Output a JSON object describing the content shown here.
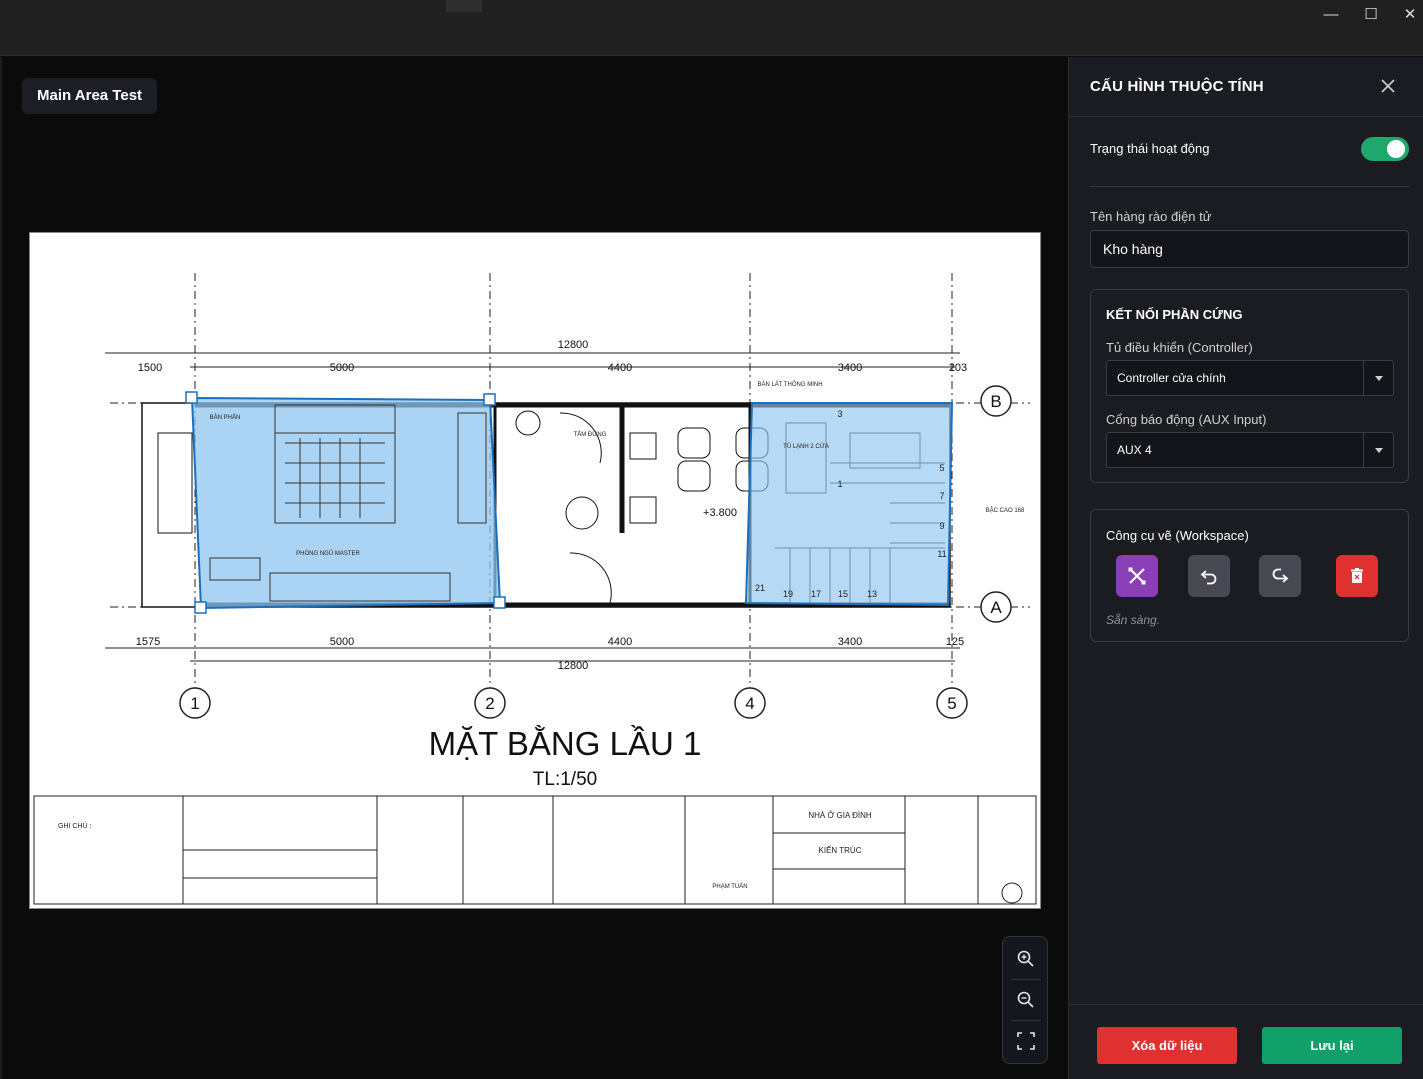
{
  "window": {
    "minimize_glyph": "—",
    "maximize_glyph": "☐",
    "close_glyph": "✕"
  },
  "canvas": {
    "area_name": "Main Area Test",
    "drawing": {
      "title": "MẶT BẰNG LẦU 1",
      "scale": "TL:1/50",
      "dim_top_total": "12800",
      "dim_bottom_total": "12800",
      "dim_top": [
        "1500",
        "5000",
        "4400",
        "3400",
        "203"
      ],
      "dim_bottom": [
        "1575",
        "5000",
        "4400",
        "3400",
        "125"
      ],
      "grid_columns": [
        "1",
        "2",
        "4",
        "5"
      ],
      "grid_rows": [
        "B",
        "A"
      ],
      "level": "+3.800",
      "room_labels": [
        "BÀN PHẤN",
        "PHÒNG NGỦ MASTER",
        "TẮM ĐỨNG",
        "BÀN LÁT THÔNG MINH",
        "TỦ LẠNH 2 CỬA",
        "BẬC CAO 168"
      ],
      "stair_numbers": [
        "3",
        "1",
        "5",
        "7",
        "9",
        "11",
        "21",
        "19",
        "17",
        "15",
        "13"
      ],
      "notes_title": "GHI CHÚ :",
      "project_label": "NHÀ Ở GIA ĐÌNH",
      "category_label": "KIẾN TRÚC",
      "designer_label": "PHẠM TUẤN"
    },
    "selection_color": "#8fc4ef",
    "selection_stroke": "#1a6fbf"
  },
  "zoom": {
    "zoom_in_icon": "zoom-in-icon",
    "zoom_out_icon": "zoom-out-icon",
    "fit_icon": "fit-screen-icon"
  },
  "panel": {
    "title": "CẤU HÌNH THUỘC TÍNH",
    "status_label": "Trạng thái hoạt động",
    "status_on": true,
    "name_label": "Tên hàng rào điện tử",
    "name_value": "Kho hàng",
    "hardware": {
      "title": "KẾT NỐI PHẦN CỨNG",
      "controller_label": "Tủ điều khiển (Controller)",
      "controller_value": "Controller cửa chính",
      "aux_label": "Cổng báo động (AUX Input)",
      "aux_value": "AUX 4"
    },
    "workspace": {
      "title": "Công cụ vẽ (Workspace)",
      "status": "Sẵn sàng.",
      "draw_color": "#8b3fb6",
      "delete_color": "#e03131"
    },
    "footer": {
      "clear_label": "Xóa dữ liệu",
      "save_label": "Lưu lại"
    },
    "accent": "#1fa86b"
  }
}
